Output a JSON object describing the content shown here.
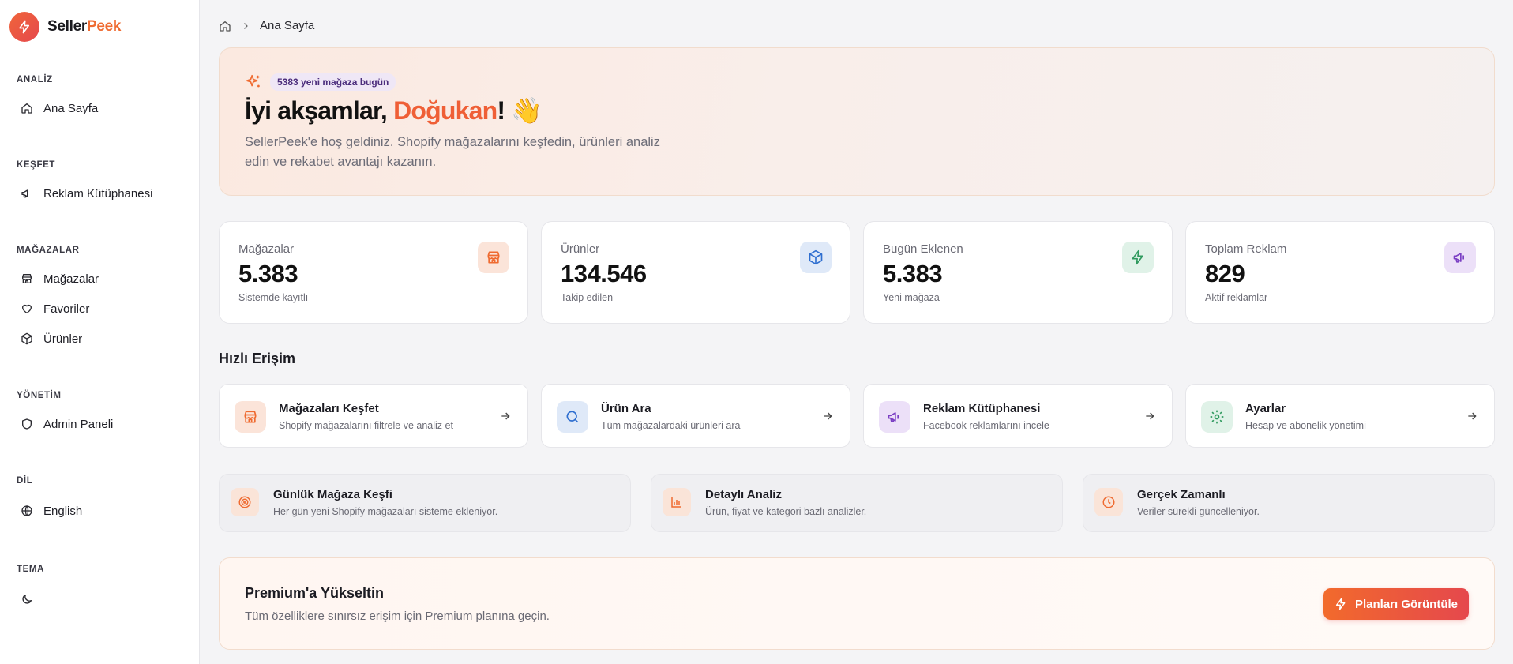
{
  "brand": {
    "part1": "Seller",
    "part2": "Peek"
  },
  "colors": {
    "accent": "#ef6b31",
    "brand_gradient": [
      "#f0653a",
      "#e5484d"
    ]
  },
  "sidebar": {
    "sections": [
      {
        "title": "ANALİZ",
        "items": [
          {
            "label": "Ana Sayfa",
            "icon": "home-icon"
          }
        ]
      },
      {
        "title": "KEŞFET",
        "items": [
          {
            "label": "Reklam Kütüphanesi",
            "icon": "megaphone-icon"
          }
        ]
      },
      {
        "title": "MAĞAZALAR",
        "items": [
          {
            "label": "Mağazalar",
            "icon": "store-icon"
          },
          {
            "label": "Favoriler",
            "icon": "heart-icon"
          },
          {
            "label": "Ürünler",
            "icon": "package-icon"
          }
        ]
      },
      {
        "title": "YÖNETİM",
        "items": [
          {
            "label": "Admin Paneli",
            "icon": "shield-icon"
          }
        ]
      },
      {
        "title": "DİL",
        "items": [
          {
            "label": "English",
            "icon": "globe-icon"
          }
        ]
      },
      {
        "title": "TEMA",
        "items": [
          {
            "label": "",
            "icon": "moon-icon"
          }
        ]
      }
    ]
  },
  "breadcrumb": {
    "current": "Ana Sayfa"
  },
  "hero": {
    "pill": "5383 yeni mağaza bugün",
    "greeting_prefix": "İyi akşamlar, ",
    "name": "Doğukan",
    "greeting_suffix": "! 👋",
    "description": "SellerPeek'e hoş geldiniz. Shopify mağazalarını keşfedin, ürünleri analiz edin ve rekabet avantajı kazanın."
  },
  "stats": [
    {
      "label": "Mağazalar",
      "value": "5.383",
      "sub": "Sistemde kayıtlı",
      "icon": "store-icon",
      "color": "#ef6b31"
    },
    {
      "label": "Ürünler",
      "value": "134.546",
      "sub": "Takip edilen",
      "icon": "package-icon",
      "color": "#2f6fd0"
    },
    {
      "label": "Bugün Eklenen",
      "value": "5.383",
      "sub": "Yeni mağaza",
      "icon": "lightning-icon",
      "color": "#2f9a5e"
    },
    {
      "label": "Toplam Reklam",
      "value": "829",
      "sub": "Aktif reklamlar",
      "icon": "megaphone-icon",
      "color": "#7b3fc4"
    }
  ],
  "quick_access": {
    "title": "Hızlı Erişim",
    "items": [
      {
        "title": "Mağazaları Keşfet",
        "desc": "Shopify mağazalarını filtrele ve analiz et",
        "icon": "store-icon"
      },
      {
        "title": "Ürün Ara",
        "desc": "Tüm mağazalardaki ürünleri ara",
        "icon": "search-icon"
      },
      {
        "title": "Reklam Kütüphanesi",
        "desc": "Facebook reklamlarını incele",
        "icon": "megaphone-icon"
      },
      {
        "title": "Ayarlar",
        "desc": "Hesap ve abonelik yönetimi",
        "icon": "gear-icon"
      }
    ]
  },
  "features": [
    {
      "title": "Günlük Mağaza Keşfi",
      "desc": "Her gün yeni Shopify mağazaları sisteme ekleniyor.",
      "icon": "target-icon"
    },
    {
      "title": "Detaylı Analiz",
      "desc": "Ürün, fiyat ve kategori bazlı analizler.",
      "icon": "bar-chart-icon"
    },
    {
      "title": "Gerçek Zamanlı",
      "desc": "Veriler sürekli güncelleniyor.",
      "icon": "clock-icon"
    }
  ],
  "premium": {
    "title": "Premium'a Yükseltin",
    "desc": "Tüm özelliklere sınırsız erişim için Premium planına geçin.",
    "cta": "Planları Görüntüle"
  }
}
